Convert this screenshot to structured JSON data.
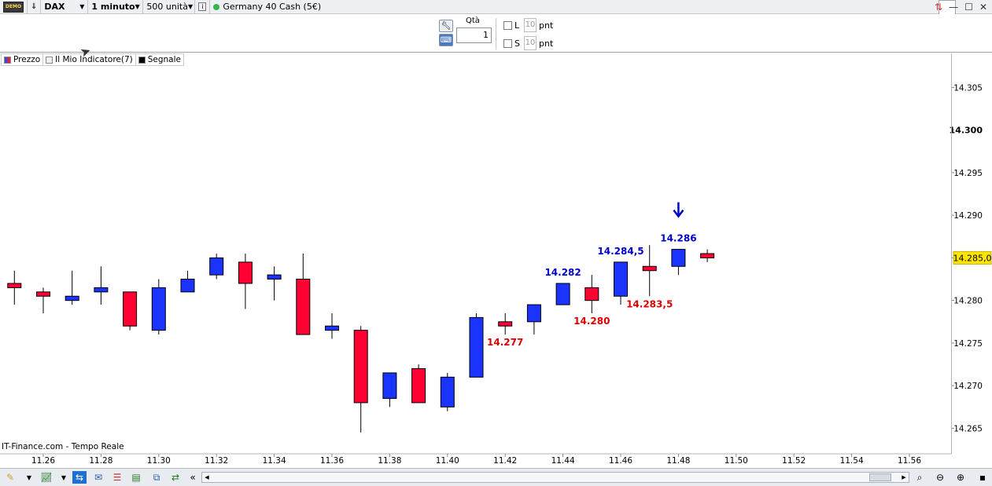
{
  "toolbar": {
    "demo_badge": "DEMO",
    "instrument": "DAX",
    "timeframe": "1 minuto",
    "units": "500 unità",
    "info_icon": "i",
    "market_name": "Germany 40 Cash (5€)",
    "status_color": "#39b54a"
  },
  "ticket": {
    "qty_label": "Qtà",
    "qty_value": "1",
    "long_label": "L",
    "short_label": "S",
    "long_pnt_placeholder": "10",
    "short_pnt_placeholder": "10",
    "pnt_label": "pnt"
  },
  "legend": [
    {
      "label": "Prezzo",
      "swatch": "#3b48d9"
    },
    {
      "label": "Il Mio Indicatore(7)",
      "swatch": "#f0f0f0"
    },
    {
      "label": "Segnale",
      "swatch": "#000000"
    }
  ],
  "source_label": "IT-Finance.com - Tempo Reale",
  "colors": {
    "bull": "#1a33ff",
    "bear": "#ff0033",
    "label_high": "#0000cc",
    "label_low": "#dd0000",
    "arrow": "#0000cc",
    "last_price_bg": "#ffe500"
  },
  "chart_data": {
    "type": "candlestick",
    "y_range": [
      14262,
      14309
    ],
    "x_ticks": [
      "11.26",
      "11.28",
      "11.30",
      "11.32",
      "11.34",
      "11.36",
      "11.38",
      "11.40",
      "11.42",
      "11.44",
      "11.46",
      "11.48",
      "11.50",
      "11.52",
      "11.54",
      "11.56"
    ],
    "y_ticks": [
      {
        "value": 14265,
        "label": "14.265"
      },
      {
        "value": 14270,
        "label": "14.270"
      },
      {
        "value": 14275,
        "label": "14.275"
      },
      {
        "value": 14280,
        "label": "14.280"
      },
      {
        "value": 14285,
        "label": "14.285"
      },
      {
        "value": 14290,
        "label": "14.290"
      },
      {
        "value": 14295,
        "label": "14.295"
      },
      {
        "value": 14300,
        "label": "14.300",
        "bold": true
      },
      {
        "value": 14305,
        "label": "14.305"
      }
    ],
    "last_price_label": "14.285,0",
    "last_price": 14285,
    "candles": [
      {
        "time": "11.25",
        "open": 14282,
        "high": 14283.5,
        "low": 14279.5,
        "close": 14281.5
      },
      {
        "time": "11.26",
        "open": 14281,
        "high": 14281.5,
        "low": 14278.5,
        "close": 14280.5
      },
      {
        "time": "11.27",
        "open": 14280,
        "high": 14283.5,
        "low": 14279.5,
        "close": 14280.5
      },
      {
        "time": "11.28",
        "open": 14281,
        "high": 14284,
        "low": 14279.5,
        "close": 14281.5
      },
      {
        "time": "11.29",
        "open": 14281,
        "high": 14281,
        "low": 14276.5,
        "close": 14277
      },
      {
        "time": "11.30",
        "open": 14276.5,
        "high": 14282.5,
        "low": 14276,
        "close": 14281.5
      },
      {
        "time": "11.31",
        "open": 14281,
        "high": 14283.5,
        "low": 14281,
        "close": 14282.5
      },
      {
        "time": "11.32",
        "open": 14283,
        "high": 14285.5,
        "low": 14282.5,
        "close": 14285
      },
      {
        "time": "11.33",
        "open": 14284.5,
        "high": 14285.5,
        "low": 14279,
        "close": 14282
      },
      {
        "time": "11.34",
        "open": 14282.5,
        "high": 14284,
        "low": 14280,
        "close": 14283
      },
      {
        "time": "11.35",
        "open": 14282.5,
        "high": 14285.5,
        "low": 14276,
        "close": 14276
      },
      {
        "time": "11.36",
        "open": 14276.5,
        "high": 14278.5,
        "low": 14275.5,
        "close": 14277
      },
      {
        "time": "11.37",
        "open": 14276.5,
        "high": 14277,
        "low": 14264.5,
        "close": 14268
      },
      {
        "time": "11.38",
        "open": 14268.5,
        "high": 14271.5,
        "low": 14267.5,
        "close": 14271.5
      },
      {
        "time": "11.39",
        "open": 14272,
        "high": 14272.5,
        "low": 14268,
        "close": 14268
      },
      {
        "time": "11.40",
        "open": 14267.5,
        "high": 14271.5,
        "low": 14267,
        "close": 14271
      },
      {
        "time": "11.41",
        "open": 14271,
        "high": 14278.5,
        "low": 14271,
        "close": 14278
      },
      {
        "time": "11.42",
        "open": 14277.5,
        "high": 14278.5,
        "low": 14276,
        "close": 14277
      },
      {
        "time": "11.43",
        "open": 14277.5,
        "high": 14279.5,
        "low": 14276,
        "close": 14279.5
      },
      {
        "time": "11.44",
        "open": 14279.5,
        "high": 14282,
        "low": 14279.5,
        "close": 14282
      },
      {
        "time": "11.45",
        "open": 14281.5,
        "high": 14283,
        "low": 14278.5,
        "close": 14280
      },
      {
        "time": "11.46",
        "open": 14280.5,
        "high": 14284.5,
        "low": 14279.5,
        "close": 14284.5
      },
      {
        "time": "11.47",
        "open": 14284,
        "high": 14286.5,
        "low": 14280.5,
        "close": 14283.5
      },
      {
        "time": "11.48",
        "open": 14284,
        "high": 14286,
        "low": 14283,
        "close": 14286
      },
      {
        "time": "11.49",
        "open": 14285.5,
        "high": 14286,
        "low": 14284.5,
        "close": 14285
      }
    ],
    "annotations": [
      {
        "time": "11.42",
        "value": 14277,
        "text": "14.277",
        "position": "below",
        "kind": "low"
      },
      {
        "time": "11.44",
        "value": 14282,
        "text": "14.282",
        "position": "above",
        "kind": "high"
      },
      {
        "time": "11.45",
        "value": 14280,
        "text": "14.280",
        "position": "below",
        "kind": "low"
      },
      {
        "time": "11.46",
        "value": 14284.5,
        "text": "14.284,5",
        "position": "above",
        "kind": "high"
      },
      {
        "time": "11.47",
        "value": 14283.5,
        "text": "14.283,5",
        "position": "below",
        "kind": "low"
      },
      {
        "time": "11.48",
        "value": 14286,
        "text": "14.286",
        "position": "above",
        "kind": "high"
      }
    ],
    "signals": [
      {
        "time": "11.48",
        "direction": "down"
      }
    ]
  }
}
